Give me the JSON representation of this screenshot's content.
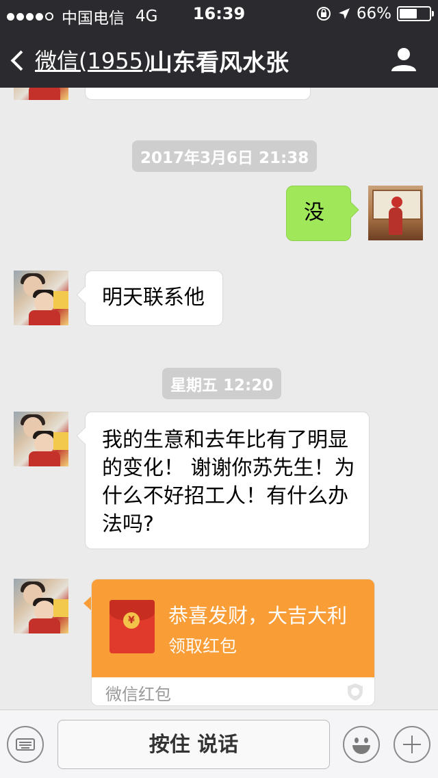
{
  "status_bar": {
    "carrier": "中国电信",
    "network": "4G",
    "time": "16:39",
    "battery": "66%",
    "battery_level": 0.66,
    "signal_bars_filled": 4,
    "signal_bars_total": 5
  },
  "nav": {
    "back_label": "微信(1955)",
    "title": "山东看风水张"
  },
  "messages": [
    {
      "type": "timestamp",
      "text": "2017年3月6日 21:38"
    },
    {
      "type": "text",
      "side": "right",
      "text": "没"
    },
    {
      "type": "text",
      "side": "left",
      "text": "明天联系他"
    },
    {
      "type": "timestamp",
      "text": "星期五 12:20"
    },
    {
      "type": "text",
      "side": "left",
      "text": "我的生意和去年比有了明显的变化！ 谢谢你苏先生！为什么不好招工人！有什么办法吗?"
    },
    {
      "type": "red_packet",
      "side": "left",
      "title": "恭喜发财，大吉大利",
      "subtitle": "领取红包",
      "footer": "微信红包"
    }
  ],
  "input_bar": {
    "hold_to_talk": "按住 说话"
  },
  "colors": {
    "header_bg": "#2b2b2f",
    "chat_bg": "#ebebeb",
    "my_bubble": "#a0e75a",
    "red_packet": "#f99d37"
  }
}
